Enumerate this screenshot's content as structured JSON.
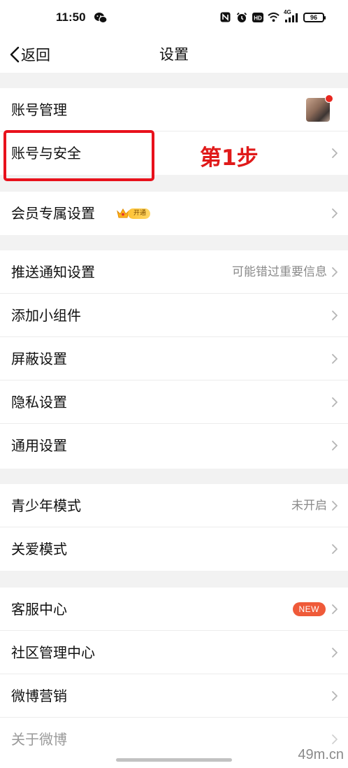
{
  "status": {
    "time": "11:50",
    "network": "4G",
    "battery": "96"
  },
  "nav": {
    "back_label": "返回",
    "title": "设置"
  },
  "rows": {
    "account_manage": "账号管理",
    "account_security": "账号与安全",
    "vip_settings": "会员专属设置",
    "vip_tag": "开通",
    "push_settings": "推送通知设置",
    "push_value": "可能错过重要信息",
    "add_widget": "添加小组件",
    "block_settings": "屏蔽设置",
    "privacy_settings": "隐私设置",
    "general_settings": "通用设置",
    "teen_mode": "青少年模式",
    "teen_value": "未开启",
    "care_mode": "关爱模式",
    "customer_service": "客服中心",
    "new_badge": "NEW",
    "community_center": "社区管理中心",
    "weibo_marketing": "微博营销",
    "about_weibo": "关于微博"
  },
  "annotation": {
    "step_label": "第1步"
  },
  "watermark": "49m.cn",
  "colors": {
    "highlight": "#e8111c",
    "step_text": "#e01a1a",
    "new_badge": "#ef5a39",
    "background": "#f2f2f2"
  }
}
